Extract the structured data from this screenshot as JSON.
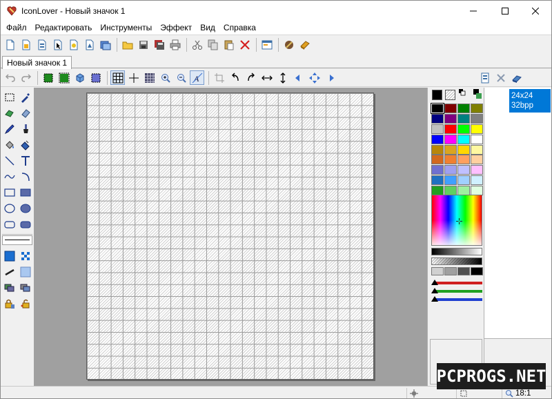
{
  "window": {
    "title": "IconLover - Новый значок 1",
    "controls": {
      "minimize": "minimize-icon",
      "maximize": "maximize-icon",
      "close": "close-icon"
    }
  },
  "menu": [
    "Файл",
    "Редактировать",
    "Инструменты",
    "Эффект",
    "Вид",
    "Справка"
  ],
  "main_toolbar": [
    "new-icon-file-icon",
    "new-cursor-icon",
    "new-library-icon",
    "new-animated-cursor-icon",
    "new-image-icon",
    "new-project-icon",
    "batch-icon",
    "open-folder-icon",
    "save-icon",
    "save-all-icon",
    "print-icon",
    "cut-icon",
    "copy-icon",
    "paste-icon",
    "delete-icon",
    "properties-icon",
    "icon-extract-icon",
    "library-book-icon"
  ],
  "tab": {
    "label": "Новый значок 1"
  },
  "edit_toolbar": [
    "undo-icon",
    "redo-icon",
    "select-all-icon",
    "select-none-icon",
    "cube-icon",
    "select-frame-icon",
    "grid-icon",
    "crosshair-icon",
    "pixel-grid-icon",
    "zoom-in-icon",
    "zoom-out-icon",
    "antialias-icon",
    "crop-icon",
    "rotate-left-icon",
    "rotate-right-icon",
    "flip-horizontal-icon",
    "flip-vertical-icon",
    "move-left-icon",
    "move-all-icon",
    "move-right-icon"
  ],
  "format_toolbar": [
    "new-format-icon",
    "delete-format-icon",
    "eraser-format-icon"
  ],
  "tools": [
    "rect-select-icon",
    "eyedropper-icon",
    "lasso-icon",
    "eraser-icon",
    "pencil-icon",
    "brush-icon",
    "fill-icon",
    "spray-icon",
    "line-icon",
    "text-icon",
    "curve-icon",
    "arc-icon",
    "rectangle-icon",
    "filled-rectangle-icon",
    "ellipse-icon",
    "filled-ellipse-icon",
    "rounded-rect-icon",
    "filled-rounded-rect-icon"
  ],
  "tools_bottom": [
    "color-fill-mode-icon",
    "blur-icon",
    "stroke-width-icon",
    "gradient-icon",
    "layers-icon",
    "layers-alt-icon",
    "lock-icon",
    "unlock-icon"
  ],
  "colors": {
    "fg": "#000000",
    "palette": [
      "#000000",
      "#800000",
      "#008000",
      "#808000",
      "#000080",
      "#800080",
      "#008080",
      "#808080",
      "#c0c0c0",
      "#ff0000",
      "#00ff00",
      "#ffff00",
      "#0000ff",
      "#ff00ff",
      "#00ffff",
      "#ffffff",
      "#b8860b",
      "#daa520",
      "#ffd700",
      "#fff8a0",
      "#d2691e",
      "#f08030",
      "#ffa060",
      "#ffd0a0",
      "#7070d0",
      "#a0a0f0",
      "#c0c0ff",
      "#ffc0ff",
      "#2070c0",
      "#40a0ff",
      "#a0d0ff",
      "#d0f0ff",
      "#20a020",
      "#60d060",
      "#a0f0a0",
      "#e0ffe0"
    ],
    "alpha_swatches": [
      "#d0d0d0",
      "#a0a0a0",
      "#505050",
      "#000000"
    ],
    "sliders": [
      {
        "name": "red",
        "color": "#d02020"
      },
      {
        "name": "green",
        "color": "#20a020"
      },
      {
        "name": "blue",
        "color": "#2040d0"
      }
    ]
  },
  "formats": [
    {
      "size": "24x24",
      "depth": "32bpp"
    }
  ],
  "status": {
    "zoom": "18:1",
    "cursor_icon": "cursor-position-icon",
    "size_icon": "selection-size-icon",
    "zoom_icon": "zoom-icon"
  },
  "watermark": "PCPROGS.NET"
}
